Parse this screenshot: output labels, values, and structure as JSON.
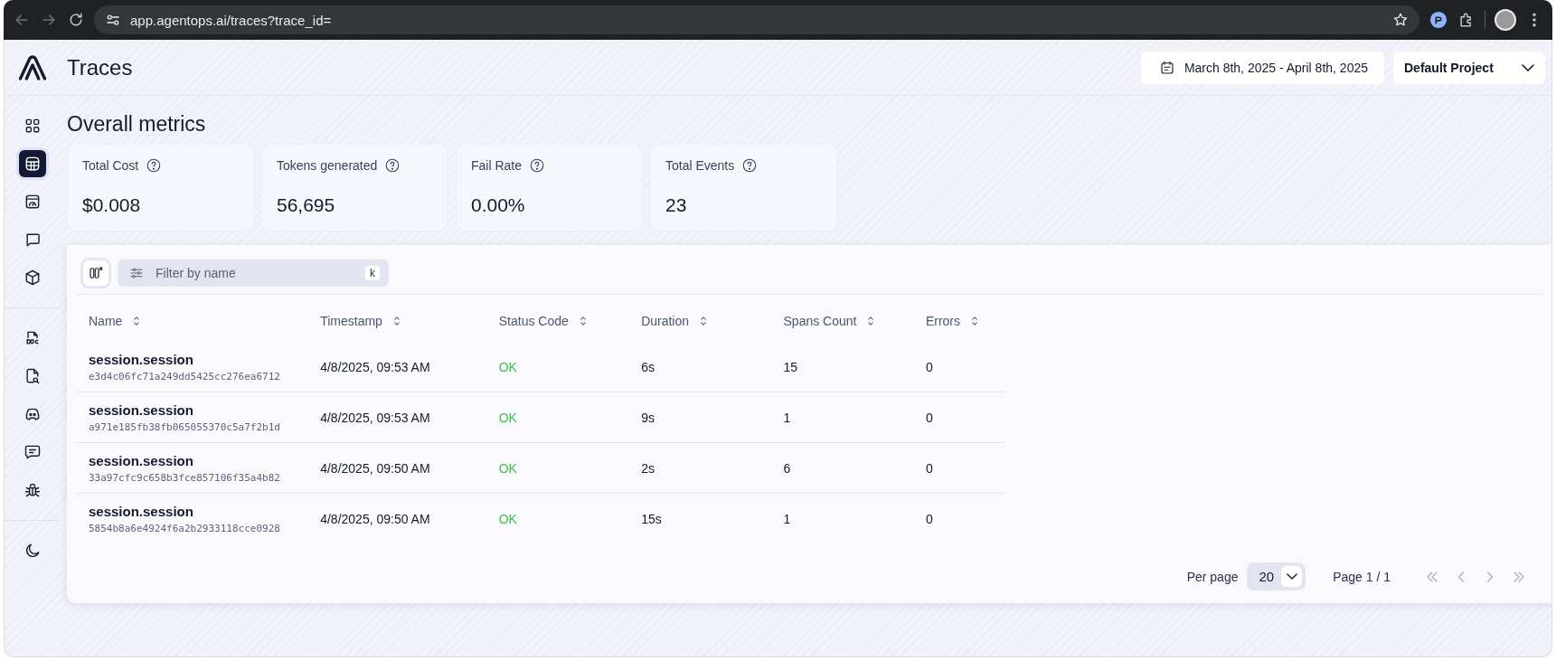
{
  "browser": {
    "url": "app.agentops.ai/traces?trace_id="
  },
  "header": {
    "title": "Traces",
    "date_range": "March 8th, 2025 - April 8th, 2025",
    "project": "Default Project"
  },
  "sidebar": {
    "groups": [
      [
        {
          "kind": "grid",
          "selected": false
        },
        {
          "kind": "table",
          "selected": true
        },
        {
          "kind": "gauge",
          "selected": false
        },
        {
          "kind": "chat",
          "selected": false
        },
        {
          "kind": "box",
          "selected": false
        }
      ],
      [
        {
          "kind": "doc",
          "selected": false
        },
        {
          "kind": "file-search",
          "selected": false
        },
        {
          "kind": "gamepad",
          "selected": false
        },
        {
          "kind": "message",
          "selected": false
        },
        {
          "kind": "bug",
          "selected": false
        }
      ],
      [
        {
          "kind": "moon",
          "selected": false
        }
      ]
    ]
  },
  "metrics": {
    "title": "Overall metrics",
    "cards": [
      {
        "label": "Total Cost",
        "value": "$0.008"
      },
      {
        "label": "Tokens generated",
        "value": "56,695"
      },
      {
        "label": "Fail Rate",
        "value": "0.00%"
      },
      {
        "label": "Total Events",
        "value": "23"
      }
    ]
  },
  "table": {
    "filter": {
      "placeholder": "Filter by name",
      "shortcut": "k"
    },
    "columns": [
      "Name",
      "Timestamp",
      "Status Code",
      "Duration",
      "Spans Count",
      "Errors"
    ],
    "rows": [
      {
        "name": "session.session",
        "id": "e3d4c06fc71a249dd5425cc276ea6712",
        "timestamp": "4/8/2025, 09:53 AM",
        "status": "OK",
        "duration": "6s",
        "spans": "15",
        "errors": "0"
      },
      {
        "name": "session.session",
        "id": "a971e185fb38fb065055370c5a7f2b1d",
        "timestamp": "4/8/2025, 09:53 AM",
        "status": "OK",
        "duration": "9s",
        "spans": "1",
        "errors": "0"
      },
      {
        "name": "session.session",
        "id": "33a97cfc9c658b3fce857106f35a4b82",
        "timestamp": "4/8/2025, 09:50 AM",
        "status": "OK",
        "duration": "2s",
        "spans": "6",
        "errors": "0"
      },
      {
        "name": "session.session",
        "id": "5854b8a6e4924f6a2b2933118cce0928",
        "timestamp": "4/8/2025, 09:50 AM",
        "status": "OK",
        "duration": "15s",
        "spans": "1",
        "errors": "0"
      }
    ]
  },
  "pagination": {
    "per_page_label": "Per page",
    "per_page": "20",
    "page": "Page 1 / 1"
  }
}
